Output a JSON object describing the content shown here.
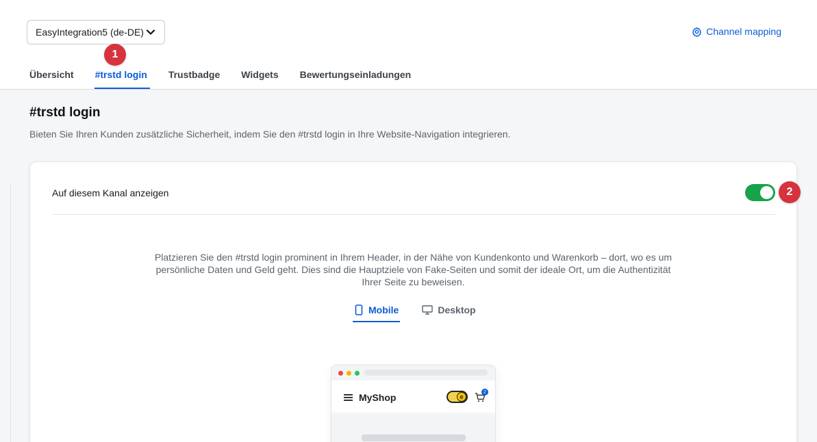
{
  "header": {
    "channel_select": "EasyIntegration5 (de-DE)",
    "channel_mapping": "Channel mapping"
  },
  "badges": {
    "one": "1",
    "two": "2"
  },
  "tabs": [
    {
      "label": "Übersicht",
      "active": false
    },
    {
      "label": "#trstd login",
      "active": true
    },
    {
      "label": "Trustbadge",
      "active": false
    },
    {
      "label": "Widgets",
      "active": false
    },
    {
      "label": "Bewertungseinladungen",
      "active": false
    }
  ],
  "page": {
    "title": "#trstd login",
    "description": "Bieten Sie Ihren Kunden zusätzliche Sicherheit, indem Sie den #trstd login in Ihre Website-Navigation integrieren."
  },
  "card": {
    "show_label": "Auf diesem Kanal anzeigen",
    "show_enabled": true,
    "info_text": "Platzieren Sie den #trstd login prominent in Ihrem Header, in der Nähe von Kundenkonto und Warenkorb – dort, wo es um persönliche Daten und Geld geht. Dies sind die Hauptziele von Fake-Seiten und somit der ideale Ort, um die Authentizität Ihrer Seite zu beweisen.",
    "view_tabs": {
      "mobile": "Mobile",
      "desktop": "Desktop",
      "active": "Mobile"
    },
    "preview": {
      "shop_name": "MyShop",
      "cart_count": "2",
      "seal_letter": "e"
    }
  },
  "colors": {
    "accent": "#0b5cd5",
    "badge": "#d6333f",
    "toggle_on": "#16a34a"
  },
  "icons": [
    "chevron-down-icon",
    "gear-icon",
    "mobile-icon",
    "desktop-icon",
    "hamburger-icon",
    "cart-icon"
  ]
}
